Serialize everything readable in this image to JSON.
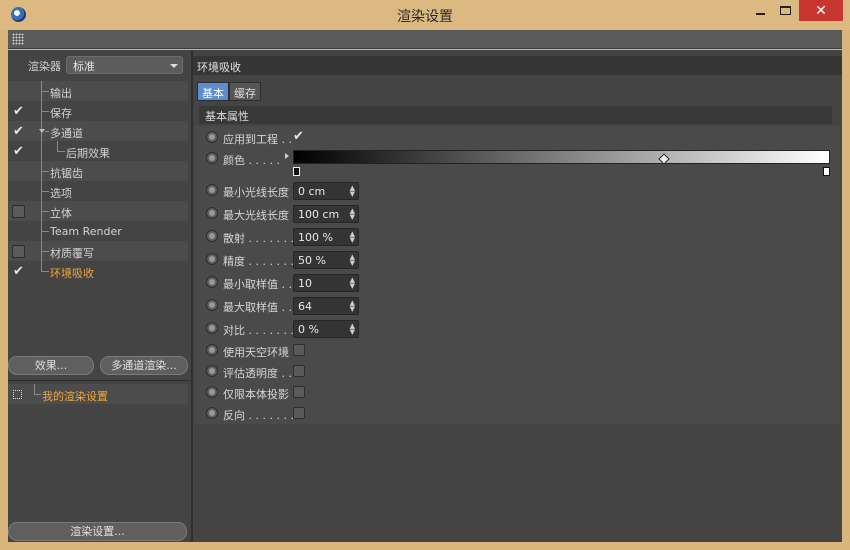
{
  "window": {
    "title": "渲染设置"
  },
  "sidebar": {
    "renderer_label": "渲染器",
    "renderer_value": "标准",
    "items": [
      {
        "label": "输出",
        "check": "none",
        "indent": 1
      },
      {
        "label": "保存",
        "check": "checked",
        "indent": 1
      },
      {
        "label": "多通道",
        "check": "checked",
        "indent": 1,
        "expanded": true
      },
      {
        "label": "后期效果",
        "check": "checked",
        "indent": 2
      },
      {
        "label": "抗锯齿",
        "check": "none",
        "indent": 1
      },
      {
        "label": "选项",
        "check": "none",
        "indent": 1
      },
      {
        "label": "立体",
        "check": "unchecked",
        "indent": 1
      },
      {
        "label": "Team Render",
        "check": "none",
        "indent": 1
      },
      {
        "label": "材质覆写",
        "check": "unchecked",
        "indent": 1
      },
      {
        "label": "环境吸收",
        "check": "checked",
        "indent": 1,
        "active": true
      }
    ],
    "effects_button": "效果...",
    "multipass_button": "多通道渲染...",
    "preset_label": "我的渲染设置",
    "render_settings_button": "渲染设置..."
  },
  "main": {
    "section_title": "环境吸收",
    "tabs": [
      {
        "label": "基本",
        "active": true
      },
      {
        "label": "缓存",
        "active": false
      }
    ],
    "group_title": "基本属性",
    "properties": [
      {
        "label": "应用到工程 . .",
        "kind": "check",
        "checked": true
      },
      {
        "label": "颜色 . . . . .",
        "kind": "gradient"
      },
      {
        "label": "最小光线长度",
        "kind": "field",
        "value": "0 cm"
      },
      {
        "label": "最大光线长度",
        "kind": "field",
        "value": "100 cm"
      },
      {
        "label": "散射 . . . . . . .",
        "kind": "field",
        "value": "100 %"
      },
      {
        "label": "精度 . . . . . . .",
        "kind": "field",
        "value": "50 %"
      },
      {
        "label": "最小取样值 . .",
        "kind": "field",
        "value": "10"
      },
      {
        "label": "最大取样值 . .",
        "kind": "field",
        "value": "64"
      },
      {
        "label": "对比 . . . . . . .",
        "kind": "field",
        "value": "0 %"
      },
      {
        "label": "使用天空环境",
        "kind": "check",
        "checked": false
      },
      {
        "label": "评估透明度 . .",
        "kind": "check",
        "checked": false
      },
      {
        "label": "仅限本体投影",
        "kind": "check",
        "checked": false
      },
      {
        "label": "反向 . . . . . . .",
        "kind": "check",
        "checked": false
      }
    ]
  },
  "icons": {
    "app": "cinema4d-logo-icon",
    "grip": "panel-grip-icon",
    "dropdown": "chevron-down-icon",
    "checkmark": "checkmark-icon",
    "preset": "render-preset-icon"
  },
  "colors": {
    "accent_orange": "#f0a83a",
    "tab_active": "#5d8ccf",
    "titlebar": "#dcb980",
    "close_red": "#c7372f"
  }
}
